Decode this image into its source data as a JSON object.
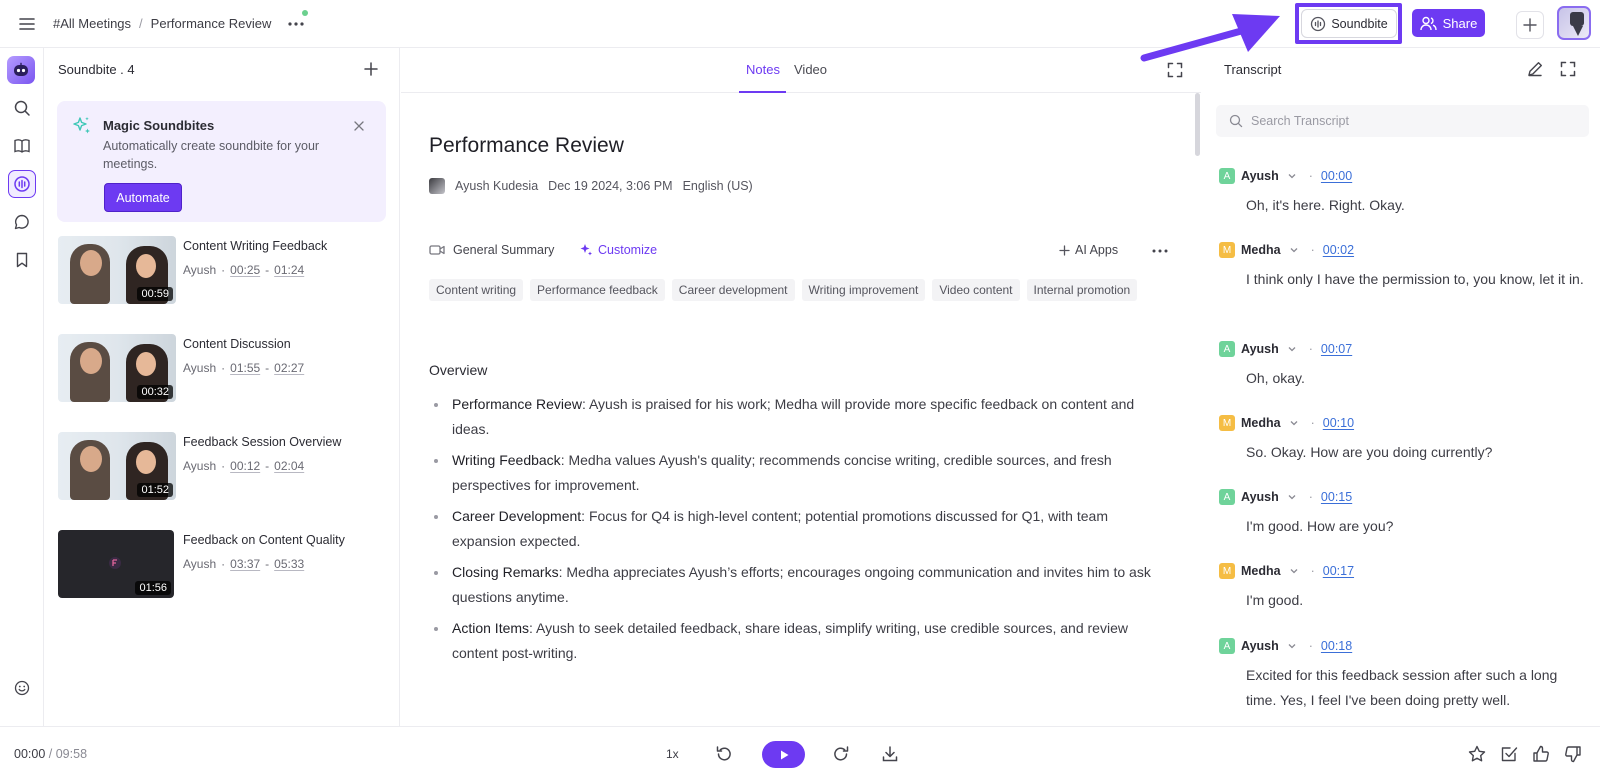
{
  "colors": {
    "accent": "#6d3af2",
    "ayush_badge": "#6fd39a",
    "medha_badge": "#f5bd44",
    "link": "#3b6fd8"
  },
  "header": {
    "breadcrumb": [
      "#All Meetings",
      "Performance Review"
    ],
    "breadcrumb_sep": "/",
    "soundbite_label": "Soundbite",
    "share_label": "Share"
  },
  "soundbites": {
    "heading": "Soundbite . 4",
    "magic": {
      "title": "Magic Soundbites",
      "description": "Automatically create soundbite for your meetings.",
      "button": "Automate"
    },
    "clips": [
      {
        "title": "Content Writing Feedback",
        "speaker": "Ayush",
        "start": "00:25",
        "end": "01:24",
        "duration": "00:59"
      },
      {
        "title": "Content Discussion",
        "speaker": "Ayush",
        "start": "01:55",
        "end": "02:27",
        "duration": "00:32"
      },
      {
        "title": "Feedback Session Overview",
        "speaker": "Ayush",
        "start": "00:12",
        "end": "02:04",
        "duration": "01:52"
      },
      {
        "title": "Feedback on Content Quality",
        "speaker": "Ayush",
        "start": "03:37",
        "end": "05:33",
        "duration": "01:56"
      }
    ],
    "meta_sep": "·",
    "range_sep": "-"
  },
  "main": {
    "tabs": [
      "Notes",
      "Video"
    ],
    "title": "Performance Review",
    "author": "Ayush Kudesia",
    "date": "Dec 19 2024, 3:06 PM",
    "language": "English (US)",
    "summary_label": "General Summary",
    "customize_label": "Customize",
    "ai_apps_label": "AI Apps",
    "tags": [
      "Content writing",
      "Performance feedback",
      "Career development",
      "Writing improvement",
      "Video content",
      "Internal promotion"
    ],
    "overview_heading": "Overview",
    "bullets": [
      {
        "label": "Performance Review",
        "text": ": Ayush is praised for his work; Medha will provide more specific feedback on content and ideas."
      },
      {
        "label": "Writing Feedback",
        "text": ": Medha values Ayush's quality; recommends concise writing, credible sources, and fresh perspectives for improvement."
      },
      {
        "label": "Career Development",
        "text": ": Focus for Q4 is high-level content; potential promotions discussed for Q1, with team expansion expected."
      },
      {
        "label": "Closing Remarks",
        "text": ": Medha appreciates Ayush’s efforts; encourages ongoing communication and invites him to ask questions anytime."
      },
      {
        "label": "Action Items",
        "text": ": Ayush to seek detailed feedback, share ideas, simplify writing, use credible sources, and review content post-writing."
      }
    ]
  },
  "transcript": {
    "heading": "Transcript",
    "search_placeholder": "Search Transcript",
    "entries": [
      {
        "initial": "A",
        "speaker": "Ayush",
        "time": "00:00",
        "text": "Oh, it's here. Right. Okay."
      },
      {
        "initial": "M",
        "speaker": "Medha",
        "time": "00:02",
        "text": "I think only I have the permission to, you know, let it in."
      },
      {
        "initial": "A",
        "speaker": "Ayush",
        "time": "00:07",
        "text": "Oh, okay."
      },
      {
        "initial": "M",
        "speaker": "Medha",
        "time": "00:10",
        "text": "So. Okay. How are you doing currently?"
      },
      {
        "initial": "A",
        "speaker": "Ayush",
        "time": "00:15",
        "text": "I'm good. How are you?"
      },
      {
        "initial": "M",
        "speaker": "Medha",
        "time": "00:17",
        "text": "I'm good."
      },
      {
        "initial": "A",
        "speaker": "Ayush",
        "time": "00:18",
        "text": "Excited for this feedback session after such a long time. Yes, I feel I've been doing pretty well."
      }
    ],
    "dot": "·"
  },
  "player": {
    "current": "00:00",
    "total": "09:58",
    "sep": "/",
    "speed": "1x"
  }
}
